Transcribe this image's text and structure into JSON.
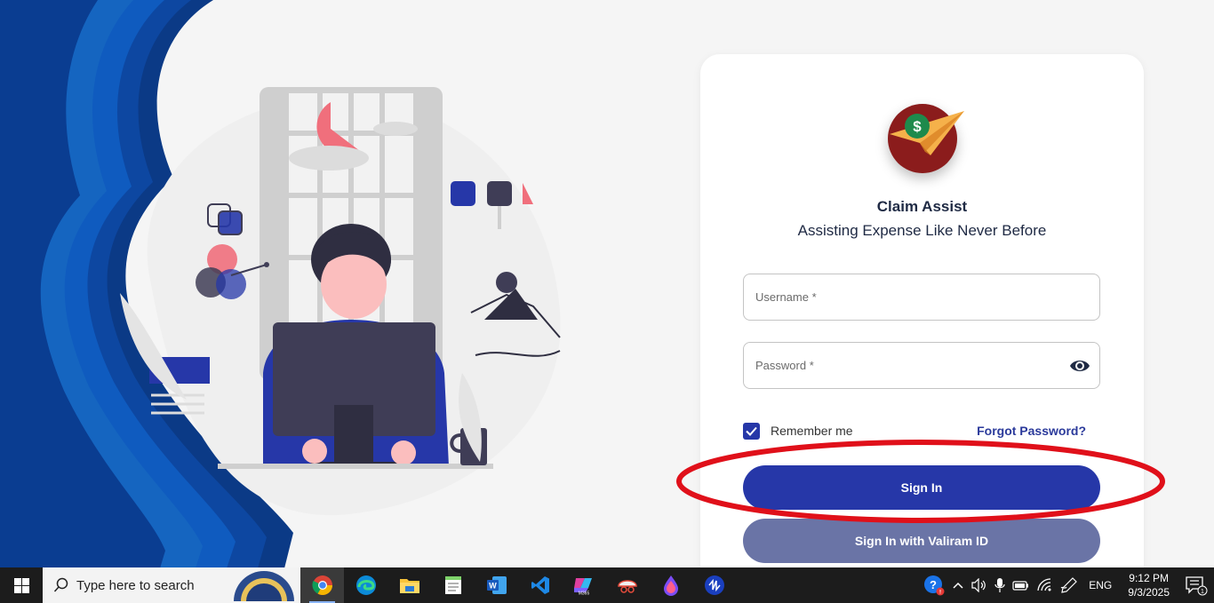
{
  "login": {
    "app_title": "Claim Assist",
    "app_subtitle": "Assisting Expense Like Never Before",
    "username_placeholder": "Username *",
    "password_placeholder": "Password *",
    "remember_label": "Remember me",
    "remember_checked": true,
    "forgot_label": "Forgot Password?",
    "signin_label": "Sign In",
    "valiram_label": "Sign In with Valiram ID"
  },
  "taskbar": {
    "search_placeholder": "Type here to search",
    "apps": [
      "chrome-icon",
      "edge-icon",
      "file-explorer-icon",
      "notepad-icon",
      "word-icon",
      "vscode-icon",
      "m365-icon",
      "snipping-tool-icon",
      "paint-icon",
      "vpn-icon"
    ],
    "language": "ENG",
    "time": "9:12 PM",
    "date": "9/3/2025",
    "notification_count": "1"
  },
  "colors": {
    "primary": "#2637a8",
    "secondary_button": "#6a74a6",
    "annotation_red": "#e0101a",
    "wave_blue": "#0a4aa0"
  }
}
